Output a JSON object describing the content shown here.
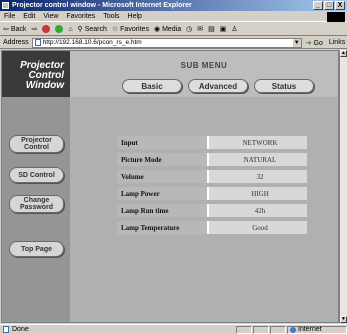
{
  "window": {
    "title": "Projector control window - Microsoft Internet Explorer",
    "btn_min": "_",
    "btn_max": "□",
    "btn_close": "X"
  },
  "menu": [
    "File",
    "Edit",
    "View",
    "Favorites",
    "Tools",
    "Help"
  ],
  "toolbar": {
    "back": "Back",
    "search": "Search",
    "favorites": "Favorites",
    "media": "Media"
  },
  "address": {
    "label": "Address",
    "url": "http://192.168.10.6/pcon_rs_e.htm",
    "go": "Go",
    "links": "Links"
  },
  "sidebar": {
    "brand": [
      "Projector",
      "Control",
      "Window"
    ],
    "items": [
      "Projector Control",
      "SD Control",
      "Change Password",
      "Top Page"
    ]
  },
  "header": {
    "title": "SUB MENU",
    "tabs": [
      "Basic",
      "Advanced",
      "Status"
    ]
  },
  "status_rows": [
    {
      "label": "Input",
      "value": "NETWORK"
    },
    {
      "label": "Picture Mode",
      "value": "NATURAL"
    },
    {
      "label": "Volume",
      "value": "32"
    },
    {
      "label": "Lamp Power",
      "value": "HIGH"
    },
    {
      "label": "Lamp Run time",
      "value": "42h"
    },
    {
      "label": "Lamp Temperature",
      "value": "Good"
    }
  ],
  "statusbar": {
    "left": "Done",
    "zone": "Internet"
  },
  "colors": {
    "titlebar": "#0a246a",
    "sidebar": "#959595",
    "brand_bg": "#3a3a3a"
  }
}
